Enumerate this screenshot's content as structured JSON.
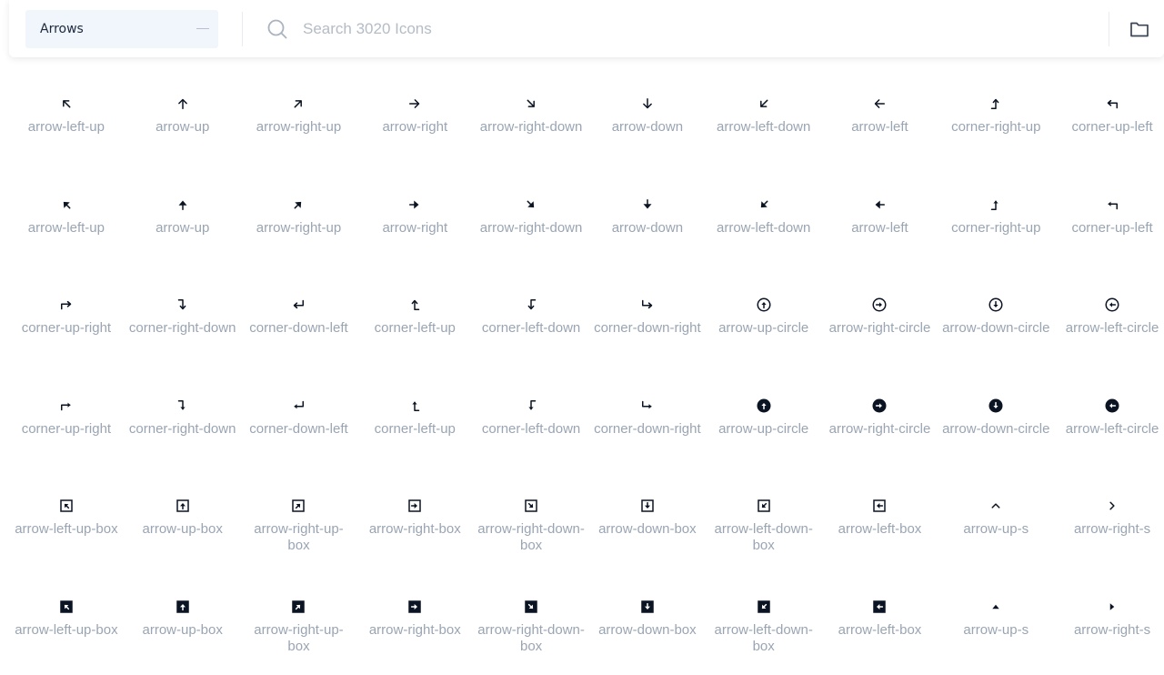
{
  "header": {
    "category": "Arrows",
    "search_placeholder": "Search 3020 Icons"
  },
  "icons": [
    {
      "label": "arrow-left-up",
      "glyph": "diag-lu",
      "style": "line"
    },
    {
      "label": "arrow-up",
      "glyph": "up",
      "style": "line"
    },
    {
      "label": "arrow-right-up",
      "glyph": "diag-ru",
      "style": "line"
    },
    {
      "label": "arrow-right",
      "glyph": "right",
      "style": "line"
    },
    {
      "label": "arrow-right-down",
      "glyph": "diag-rd",
      "style": "line"
    },
    {
      "label": "arrow-down",
      "glyph": "down",
      "style": "line"
    },
    {
      "label": "arrow-left-down",
      "glyph": "diag-ld",
      "style": "line"
    },
    {
      "label": "arrow-left",
      "glyph": "left",
      "style": "line"
    },
    {
      "label": "corner-right-up",
      "glyph": "corner-right-up",
      "style": "line"
    },
    {
      "label": "corner-up-left",
      "glyph": "corner-up-left",
      "style": "line"
    },
    {
      "label": "arrow-left-up",
      "glyph": "diag-lu",
      "style": "fill"
    },
    {
      "label": "arrow-up",
      "glyph": "up",
      "style": "fill"
    },
    {
      "label": "arrow-right-up",
      "glyph": "diag-ru",
      "style": "fill"
    },
    {
      "label": "arrow-right",
      "glyph": "right",
      "style": "fill"
    },
    {
      "label": "arrow-right-down",
      "glyph": "diag-rd",
      "style": "fill"
    },
    {
      "label": "arrow-down",
      "glyph": "down",
      "style": "fill"
    },
    {
      "label": "arrow-left-down",
      "glyph": "diag-ld",
      "style": "fill"
    },
    {
      "label": "arrow-left",
      "glyph": "left",
      "style": "fill"
    },
    {
      "label": "corner-right-up",
      "glyph": "corner-right-up",
      "style": "fill"
    },
    {
      "label": "corner-up-left",
      "glyph": "corner-up-left",
      "style": "fill"
    },
    {
      "label": "corner-up-right",
      "glyph": "corner-up-right",
      "style": "line"
    },
    {
      "label": "corner-right-down",
      "glyph": "corner-right-down",
      "style": "line"
    },
    {
      "label": "corner-down-left",
      "glyph": "corner-down-left",
      "style": "line"
    },
    {
      "label": "corner-left-up",
      "glyph": "corner-left-up",
      "style": "line"
    },
    {
      "label": "corner-left-down",
      "glyph": "corner-left-down",
      "style": "line"
    },
    {
      "label": "corner-down-right",
      "glyph": "corner-down-right",
      "style": "line"
    },
    {
      "label": "arrow-up-circle",
      "glyph": "circle-up",
      "style": "line"
    },
    {
      "label": "arrow-right-circle",
      "glyph": "circle-right",
      "style": "line"
    },
    {
      "label": "arrow-down-circle",
      "glyph": "circle-down",
      "style": "line"
    },
    {
      "label": "arrow-left-circle",
      "glyph": "circle-left",
      "style": "line"
    },
    {
      "label": "corner-up-right",
      "glyph": "corner-up-right",
      "style": "fill"
    },
    {
      "label": "corner-right-down",
      "glyph": "corner-right-down",
      "style": "fill"
    },
    {
      "label": "corner-down-left",
      "glyph": "corner-down-left",
      "style": "fill"
    },
    {
      "label": "corner-left-up",
      "glyph": "corner-left-up",
      "style": "fill"
    },
    {
      "label": "corner-left-down",
      "glyph": "corner-left-down",
      "style": "fill"
    },
    {
      "label": "corner-down-right",
      "glyph": "corner-down-right",
      "style": "fill"
    },
    {
      "label": "arrow-up-circle",
      "glyph": "circle-up",
      "style": "fill"
    },
    {
      "label": "arrow-right-circle",
      "glyph": "circle-right",
      "style": "fill"
    },
    {
      "label": "arrow-down-circle",
      "glyph": "circle-down",
      "style": "fill"
    },
    {
      "label": "arrow-left-circle",
      "glyph": "circle-left",
      "style": "fill"
    },
    {
      "label": "arrow-left-up-box",
      "glyph": "box-lu",
      "style": "line"
    },
    {
      "label": "arrow-up-box",
      "glyph": "box-up",
      "style": "line"
    },
    {
      "label": "arrow-right-up-box",
      "glyph": "box-ru",
      "style": "line"
    },
    {
      "label": "arrow-right-box",
      "glyph": "box-right",
      "style": "line"
    },
    {
      "label": "arrow-right-down-box",
      "glyph": "box-rd",
      "style": "line"
    },
    {
      "label": "arrow-down-box",
      "glyph": "box-down",
      "style": "line"
    },
    {
      "label": "arrow-left-down-box",
      "glyph": "box-ld",
      "style": "line"
    },
    {
      "label": "arrow-left-box",
      "glyph": "box-left",
      "style": "line"
    },
    {
      "label": "arrow-up-s",
      "glyph": "chev-up",
      "style": "line"
    },
    {
      "label": "arrow-right-s",
      "glyph": "chev-right",
      "style": "line"
    },
    {
      "label": "arrow-left-up-box",
      "glyph": "box-lu",
      "style": "fill"
    },
    {
      "label": "arrow-up-box",
      "glyph": "box-up",
      "style": "fill"
    },
    {
      "label": "arrow-right-up-box",
      "glyph": "box-ru",
      "style": "fill"
    },
    {
      "label": "arrow-right-box",
      "glyph": "box-right",
      "style": "fill"
    },
    {
      "label": "arrow-right-down-box",
      "glyph": "box-rd",
      "style": "fill"
    },
    {
      "label": "arrow-down-box",
      "glyph": "box-down",
      "style": "fill"
    },
    {
      "label": "arrow-left-down-box",
      "glyph": "box-ld",
      "style": "fill"
    },
    {
      "label": "arrow-left-box",
      "glyph": "box-left",
      "style": "fill"
    },
    {
      "label": "arrow-up-s",
      "glyph": "tri-up",
      "style": "fill"
    },
    {
      "label": "arrow-right-s",
      "glyph": "tri-right",
      "style": "fill"
    }
  ]
}
